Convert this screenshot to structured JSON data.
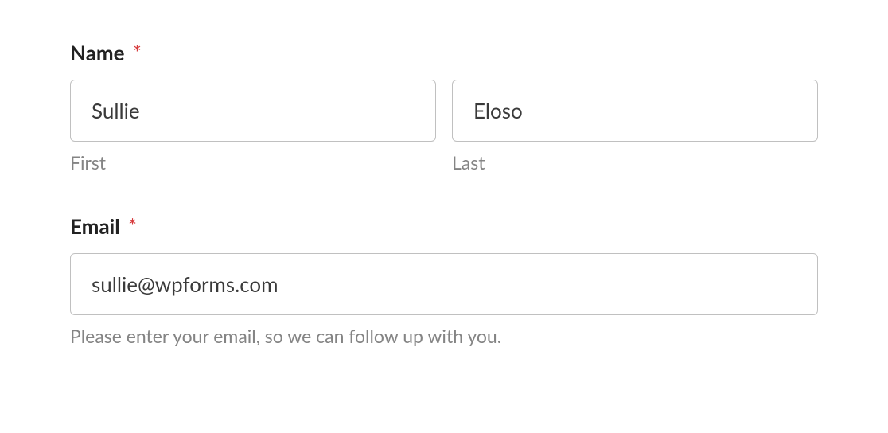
{
  "name_field": {
    "label": "Name",
    "required_marker": "*",
    "first": {
      "value": "Sullie",
      "sublabel": "First"
    },
    "last": {
      "value": "Eloso",
      "sublabel": "Last"
    }
  },
  "email_field": {
    "label": "Email",
    "required_marker": "*",
    "value": "sullie@wpforms.com",
    "description": "Please enter your email, so we can follow up with you."
  }
}
